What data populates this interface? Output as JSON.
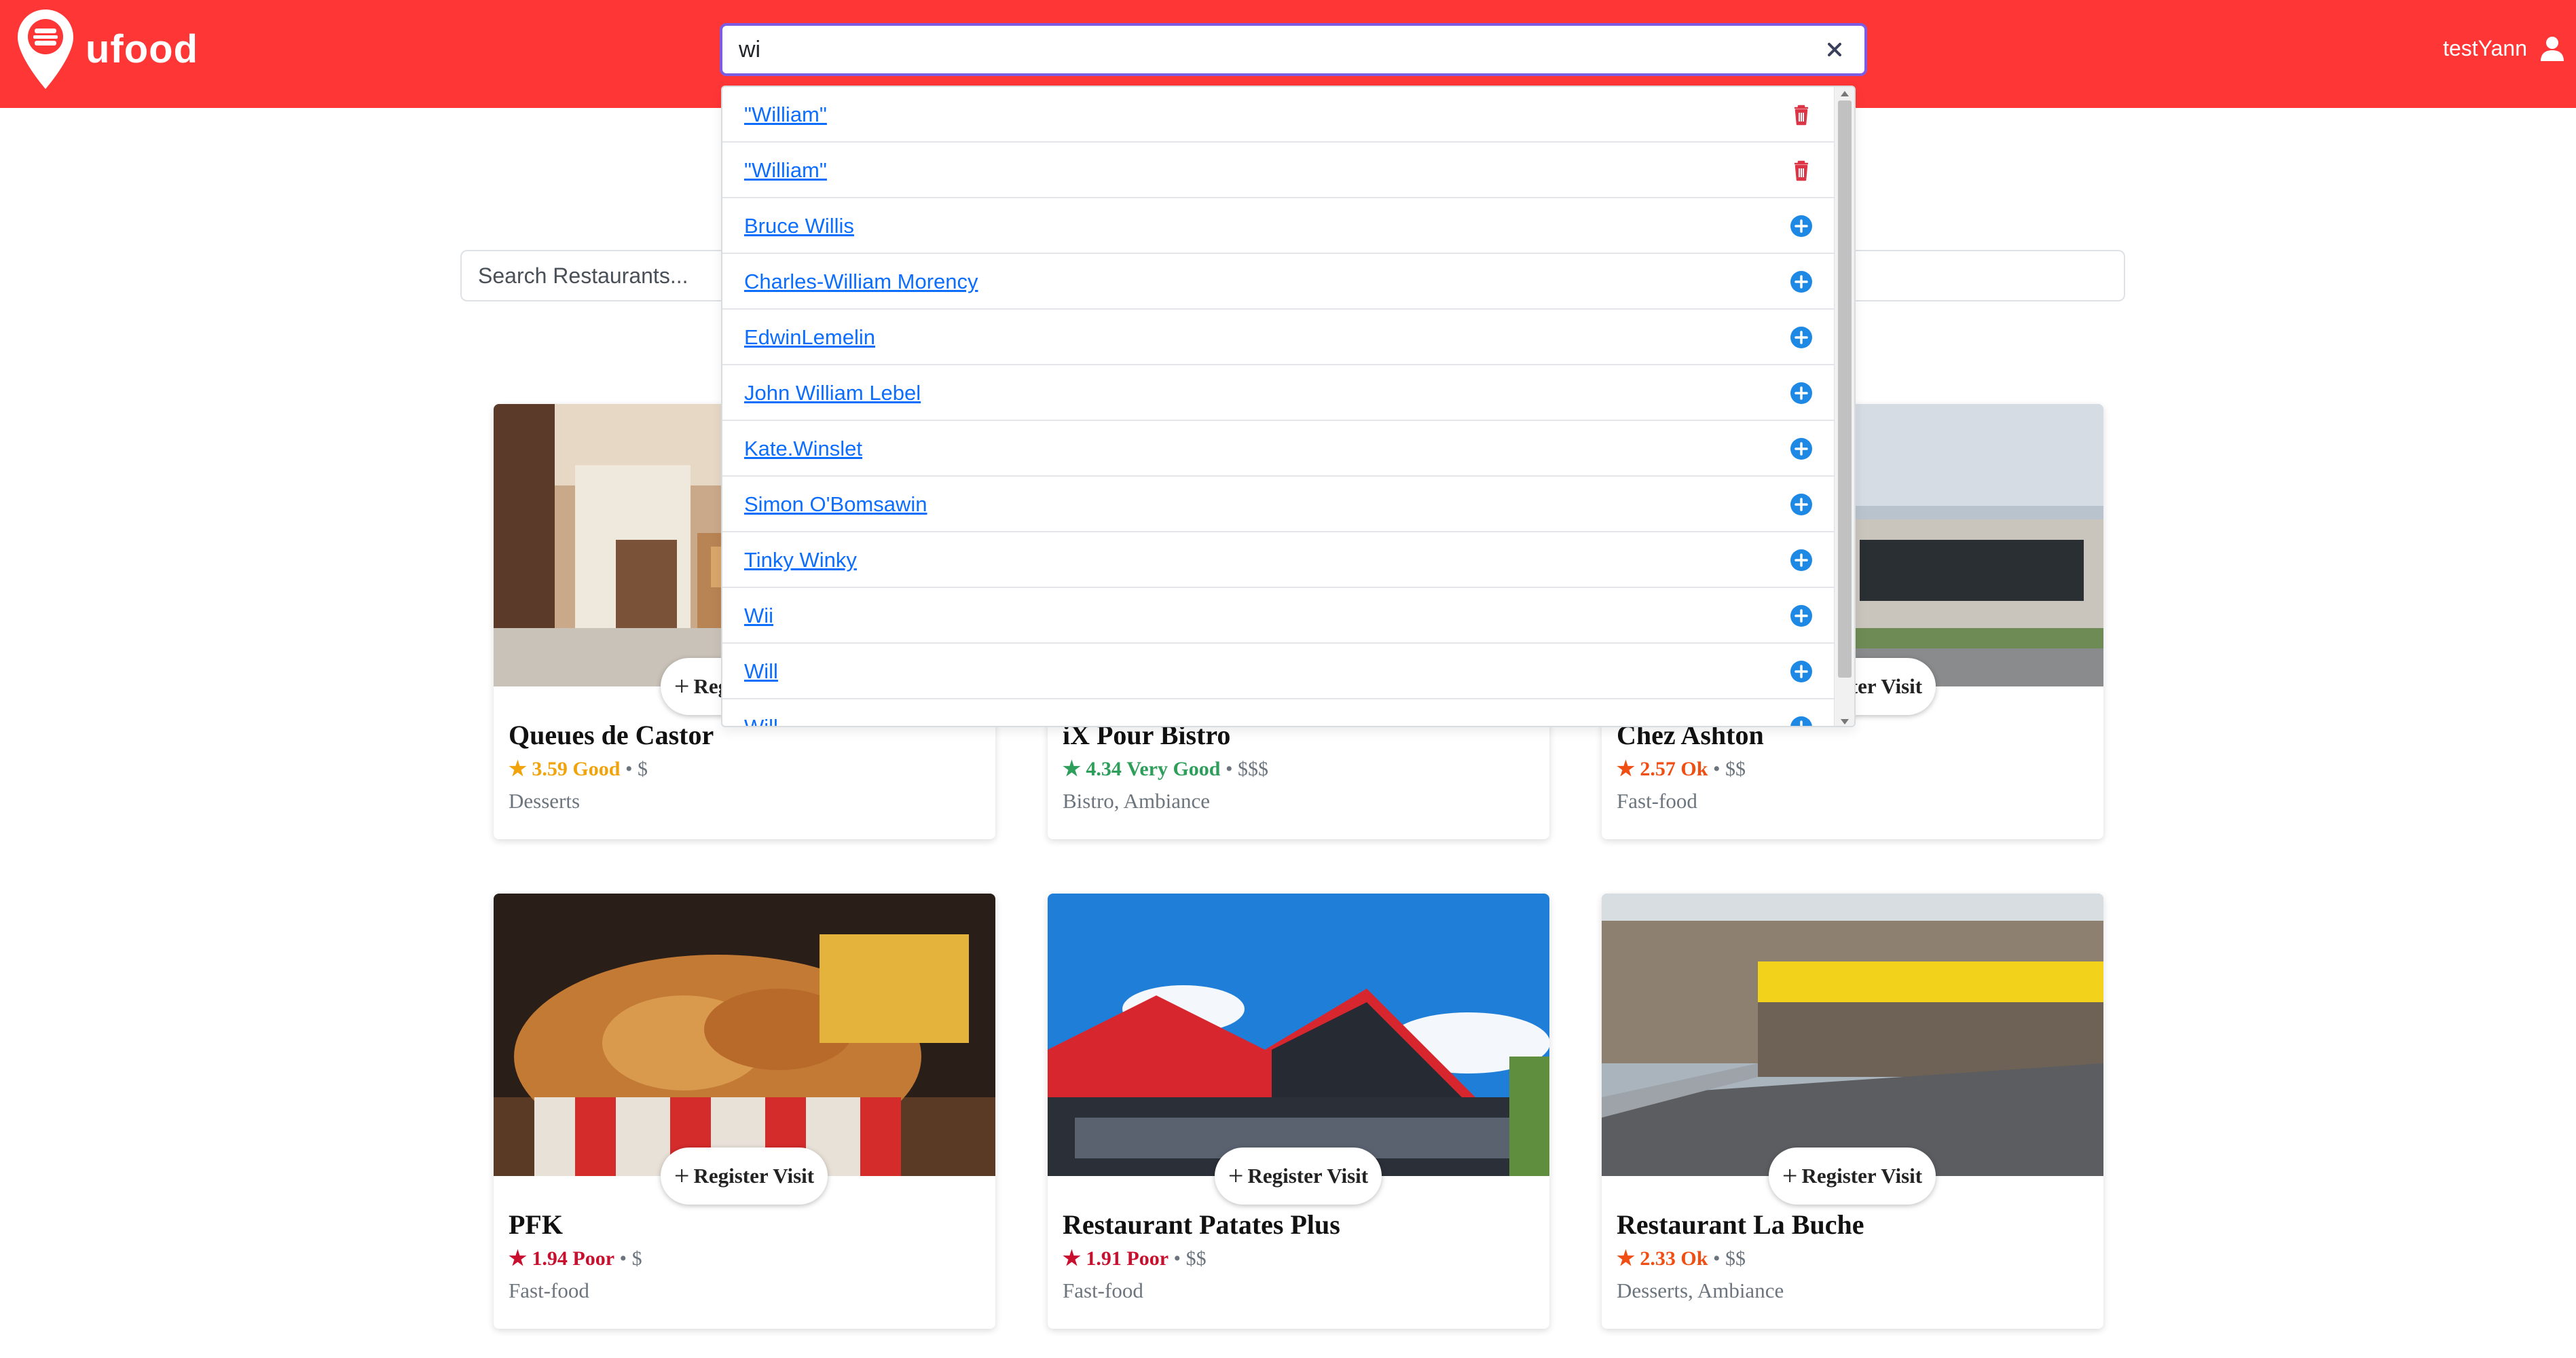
{
  "header": {
    "logo_text": "ufood",
    "username": "testYann",
    "search_value": "wi"
  },
  "dropdown": {
    "items": [
      {
        "label": "\"William\"",
        "action": "delete",
        "icon": "trash-icon"
      },
      {
        "label": "\"William\"",
        "action": "delete",
        "icon": "trash-icon"
      },
      {
        "label": "Bruce Willis",
        "action": "add",
        "icon": "plus-circle-icon"
      },
      {
        "label": "Charles-William Morency",
        "action": "add",
        "icon": "plus-circle-icon"
      },
      {
        "label": "EdwinLemelin",
        "action": "add",
        "icon": "plus-circle-icon"
      },
      {
        "label": "John William Lebel",
        "action": "add",
        "icon": "plus-circle-icon"
      },
      {
        "label": "Kate.Winslet",
        "action": "add",
        "icon": "plus-circle-icon"
      },
      {
        "label": "Simon O'Bomsawin",
        "action": "add",
        "icon": "plus-circle-icon"
      },
      {
        "label": "Tinky Winky",
        "action": "add",
        "icon": "plus-circle-icon"
      },
      {
        "label": "Wii",
        "action": "add",
        "icon": "plus-circle-icon"
      },
      {
        "label": "Will",
        "action": "add",
        "icon": "plus-circle-icon"
      },
      {
        "label": "Will",
        "action": "add",
        "icon": "plus-circle-icon"
      }
    ]
  },
  "restaurant_search": {
    "placeholder": "Search Restaurants..."
  },
  "register_label": "Register Visit",
  "restaurants": [
    {
      "name": "Queues de Castor",
      "score": "3.59",
      "quality": "Good",
      "price": "$",
      "tags": "Desserts",
      "rating_color": "#f0a30a"
    },
    {
      "name": "iX Pour Bistro",
      "score": "4.34",
      "quality": "Very Good",
      "price": "$$$",
      "tags": "Bistro, Ambiance",
      "rating_color": "#2e9e5b"
    },
    {
      "name": "Chez Ashton",
      "score": "2.57",
      "quality": "Ok",
      "price": "$$",
      "tags": "Fast-food",
      "rating_color": "#f04e13"
    },
    {
      "name": "PFK",
      "score": "1.94",
      "quality": "Poor",
      "price": "$",
      "tags": "Fast-food",
      "rating_color": "#c8102e"
    },
    {
      "name": "Restaurant Patates Plus",
      "score": "1.91",
      "quality": "Poor",
      "price": "$$",
      "tags": "Fast-food",
      "rating_color": "#c8102e"
    },
    {
      "name": "Restaurant La Buche",
      "score": "2.33",
      "quality": "Ok",
      "price": "$$",
      "tags": "Desserts, Ambiance",
      "rating_color": "#f04e13"
    }
  ],
  "colors": {
    "brand_red": "#ff3636",
    "link_blue": "#0d6efd",
    "delete_red": "#dc3545",
    "add_blue": "#1e88e5"
  }
}
